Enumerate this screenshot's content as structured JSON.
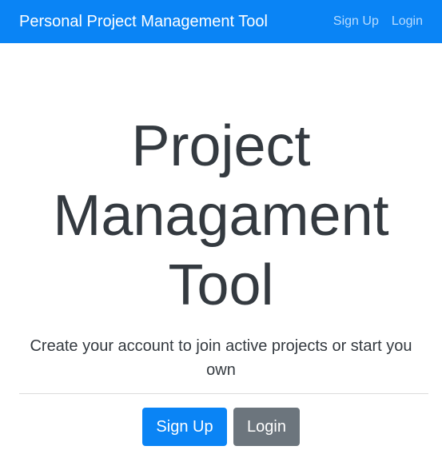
{
  "navbar": {
    "brand": "Personal Project Management Tool",
    "links": [
      {
        "label": "Sign Up"
      },
      {
        "label": "Login"
      }
    ]
  },
  "hero": {
    "title_lines": [
      "Project",
      "Managament",
      "Tool"
    ],
    "lead": "Create your account to join active projects or start you own"
  },
  "actions": {
    "signup_label": "Sign Up",
    "login_label": "Login"
  },
  "colors": {
    "primary": "#0a84f5",
    "secondary": "#6c757d",
    "text": "#343a40",
    "nav_link": "#b9dcff"
  }
}
